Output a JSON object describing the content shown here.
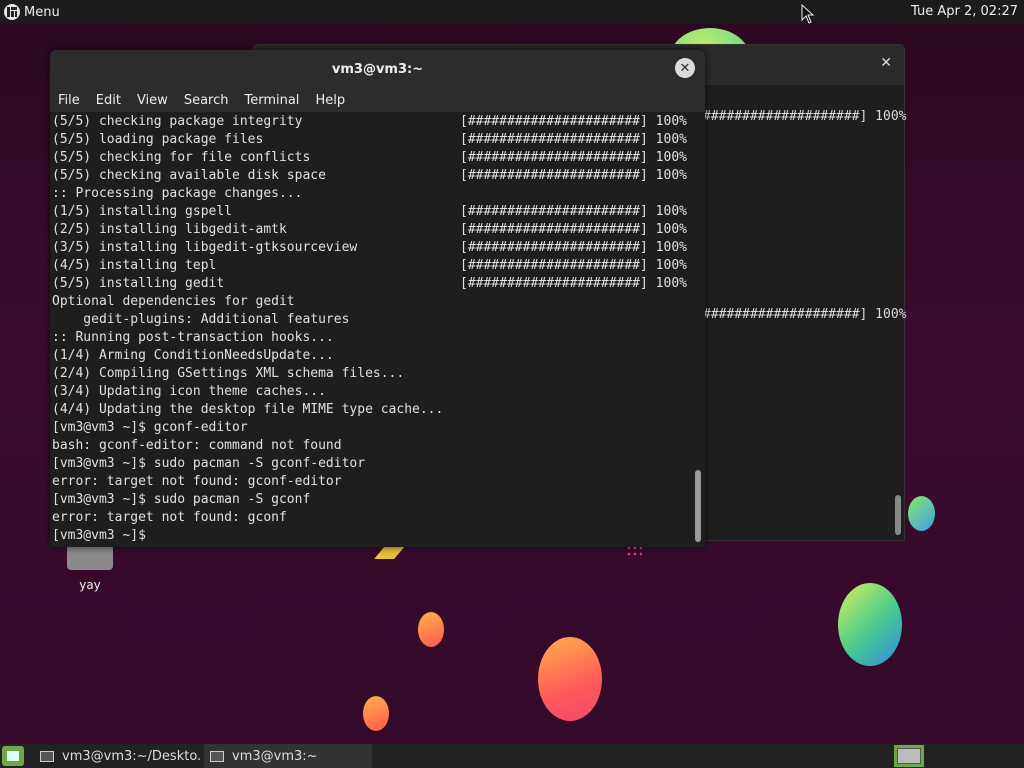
{
  "top_panel": {
    "menu_label": "Menu",
    "clock": "Tue Apr  2, 02:27"
  },
  "desktop_icon": {
    "label": "yay"
  },
  "back_window": {
    "close_glyph": "✕",
    "lines": [
      "####################] 100%",
      "####################] 100%"
    ]
  },
  "terminal": {
    "title": "vm3@vm3:~",
    "close_glyph": "✕",
    "menu": [
      "File",
      "Edit",
      "View",
      "Search",
      "Terminal",
      "Help"
    ],
    "lines": [
      {
        "left": "(5/5) checking package integrity",
        "right": "[######################] 100%"
      },
      {
        "left": "(5/5) loading package files",
        "right": "[######################] 100%"
      },
      {
        "left": "(5/5) checking for file conflicts",
        "right": "[######################] 100%"
      },
      {
        "left": "(5/5) checking available disk space",
        "right": "[######################] 100%"
      },
      {
        "left": ":: Processing package changes...",
        "right": ""
      },
      {
        "left": "(1/5) installing gspell",
        "right": "[######################] 100%"
      },
      {
        "left": "(2/5) installing libgedit-amtk",
        "right": "[######################] 100%"
      },
      {
        "left": "(3/5) installing libgedit-gtksourceview",
        "right": "[######################] 100%"
      },
      {
        "left": "(4/5) installing tepl",
        "right": "[######################] 100%"
      },
      {
        "left": "(5/5) installing gedit",
        "right": "[######################] 100%"
      },
      {
        "left": "Optional dependencies for gedit",
        "right": ""
      },
      {
        "left": "    gedit-plugins: Additional features",
        "right": ""
      },
      {
        "left": ":: Running post-transaction hooks...",
        "right": ""
      },
      {
        "left": "(1/4) Arming ConditionNeedsUpdate...",
        "right": ""
      },
      {
        "left": "(2/4) Compiling GSettings XML schema files...",
        "right": ""
      },
      {
        "left": "(3/4) Updating icon theme caches...",
        "right": ""
      },
      {
        "left": "(4/4) Updating the desktop file MIME type cache...",
        "right": ""
      },
      {
        "left": "[vm3@vm3 ~]$ gconf-editor",
        "right": ""
      },
      {
        "left": "bash: gconf-editor: command not found",
        "right": ""
      },
      {
        "left": "[vm3@vm3 ~]$ sudo pacman -S gconf-editor",
        "right": ""
      },
      {
        "left": "error: target not found: gconf-editor",
        "right": ""
      },
      {
        "left": "[vm3@vm3 ~]$ sudo pacman -S gconf",
        "right": ""
      },
      {
        "left": "error: target not found: gconf",
        "right": ""
      },
      {
        "left": "[vm3@vm3 ~]$ ",
        "right": ""
      }
    ]
  },
  "taskbar": {
    "tasks": [
      {
        "label": "vm3@vm3:~/Deskto..."
      },
      {
        "label": "vm3@vm3:~"
      }
    ]
  },
  "colors": {
    "accent": "#6fa64a",
    "terminal_bg": "#1e1e1e",
    "desktop_bg": "#3a0a2c"
  }
}
